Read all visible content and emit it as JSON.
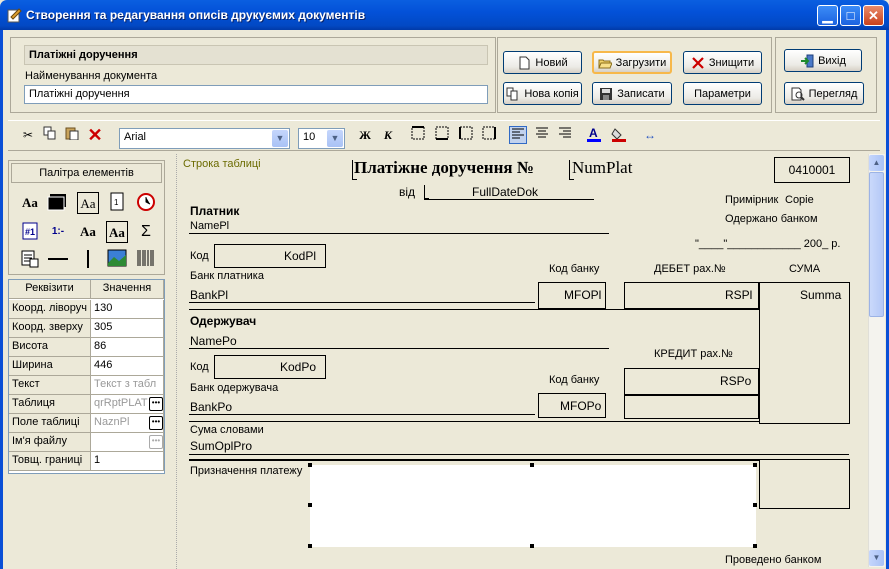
{
  "window": {
    "title": "Створення та редагування описів друкуємих документів"
  },
  "header": {
    "doc_name_display": "Платіжні доручення",
    "doc_name_label": "Найменування документа",
    "doc_name_value": "Платіжні доручення"
  },
  "buttons": {
    "new": "Новий",
    "load": "Загрузити",
    "delete": "Знищити",
    "exit": "Вихід",
    "new_copy": "Нова копія",
    "save": "Записати",
    "params": "Параметри",
    "preview": "Перегляд"
  },
  "toolbar": {
    "font_name": "Arial",
    "font_size": "10",
    "bold": "Ж",
    "italic": "К"
  },
  "palette": {
    "title": "Палітра елементів"
  },
  "props": {
    "col_name": "Реквізити",
    "col_value": "Значення",
    "rows": [
      {
        "name": "Коорд. ліворуч",
        "value": "130"
      },
      {
        "name": "Коорд. зверху",
        "value": "305"
      },
      {
        "name": "Висота",
        "value": "86"
      },
      {
        "name": "Ширина",
        "value": "446"
      },
      {
        "name": "Текст",
        "value": "Текст з табл"
      },
      {
        "name": "Таблиця",
        "value": "qrRptPLAT"
      },
      {
        "name": "Поле таблиці",
        "value": "NaznPl"
      },
      {
        "name": "Ім'я файлу",
        "value": ""
      },
      {
        "name": "Товщ. границі",
        "value": "1"
      }
    ]
  },
  "document": {
    "band_label": "Строка таблиці",
    "title": "Платіжне доручення №",
    "num": "NumPlat",
    "form_code": "0410001",
    "vid": "від",
    "date": "FullDateDok",
    "primirnyk": "Примірник",
    "copy": "Copie",
    "received": "Одержано банком",
    "date_line": "\"____\"____________ 200_ р.",
    "payer": "Платник",
    "payer_name": "NamePl",
    "kod1": "Код",
    "kod_pl": "KodPl",
    "bank_payer": "Банк платника",
    "bank_pl": "BankPl",
    "kod_banku1": "Код банку",
    "mfo_pl": "MFOPl",
    "debet": "ДЕБЕТ рах.№",
    "rs_pl": "RSPl",
    "suma": "СУМА",
    "summa": "Summa",
    "receiver": "Одержувач",
    "name_po": "NamePo",
    "kod2": "Код",
    "kod_po": "KodPo",
    "kredyt": "КРЕДИТ рах.№",
    "bank_receiver": "Банк одержувача",
    "kod_banku2": "Код банку",
    "rs_po": "RSPo",
    "bank_po": "BankPo",
    "mfo_po": "MFOPo",
    "suma_words": "Сума словами",
    "sum_opl": "SumOplPro",
    "purpose": "Призначення платежу",
    "conducted": "Проведено банком"
  }
}
